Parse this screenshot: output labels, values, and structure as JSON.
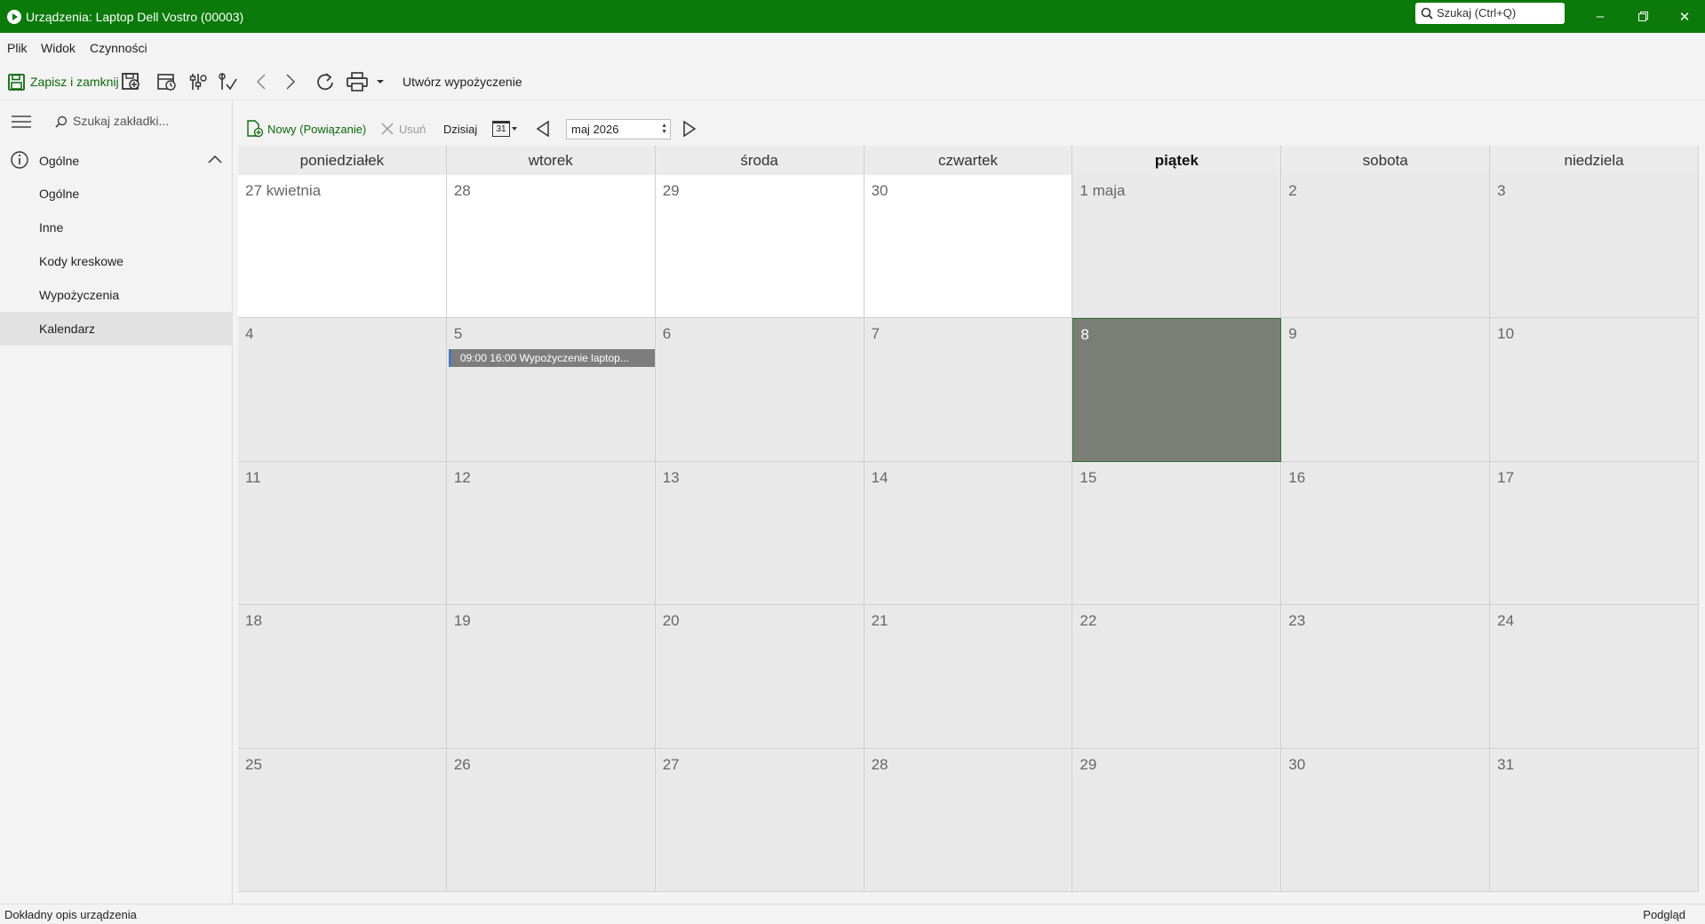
{
  "titlebar": {
    "title": "Urządzenia: Laptop Dell Vostro (00003)",
    "search_placeholder": "Szukaj (Ctrl+Q)",
    "accent": "#0b7a0b"
  },
  "menu": {
    "file": "Plik",
    "view": "Widok",
    "actions": "Czynności"
  },
  "toolbar": {
    "save_close": "Zapisz i zamknij",
    "create_rental": "Utwórz wypożyczenie"
  },
  "sidebar": {
    "search_placeholder": "Szukaj zakładki...",
    "group_label": "Ogólne",
    "items": [
      {
        "label": "Ogólne"
      },
      {
        "label": "Inne"
      },
      {
        "label": "Kody kreskowe"
      },
      {
        "label": "Wypożyczenia"
      },
      {
        "label": "Kalendarz",
        "active": true
      }
    ]
  },
  "calendar_toolbar": {
    "new_label": "Nowy (Powiązanie)",
    "delete_label": "Usuń",
    "today_label": "Dzisiaj",
    "calendar_icon_day": "31",
    "month_value": "maj 2026"
  },
  "calendar": {
    "weekdays": [
      "poniedziałek",
      "wtorek",
      "środa",
      "czwartek",
      "piątek",
      "sobota",
      "niedziela"
    ],
    "bold_weekday_index": 4,
    "weeks": [
      [
        "27 kwietnia",
        "28",
        "29",
        "30",
        "1 maja",
        "2",
        "3"
      ],
      [
        "4",
        "5",
        "6",
        "7",
        "8",
        "9",
        "10"
      ],
      [
        "11",
        "12",
        "13",
        "14",
        "15",
        "16",
        "17"
      ],
      [
        "18",
        "19",
        "20",
        "21",
        "22",
        "23",
        "24"
      ],
      [
        "25",
        "26",
        "27",
        "28",
        "29",
        "30",
        "31"
      ]
    ],
    "selected_day": "8",
    "event": {
      "day": "5",
      "text": "09:00  16:00  Wypożyczenie laptop..."
    }
  },
  "status": {
    "left": "Dokładny opis urządzenia",
    "right": "Podgląd"
  }
}
